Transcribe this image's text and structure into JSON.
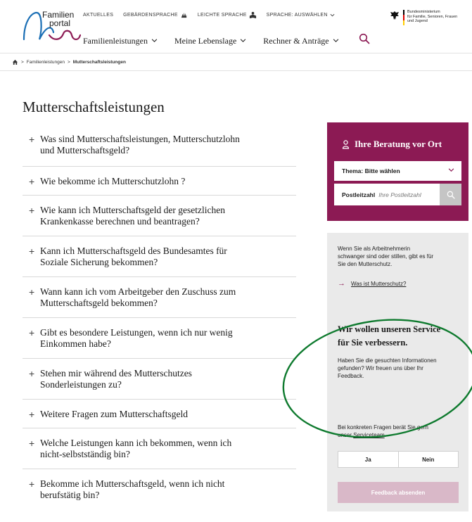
{
  "header": {
    "logo_line1": "Familien",
    "logo_line2": "portal",
    "topnav": {
      "aktuelles": "AKTUELLES",
      "gebaerdensprache": "GEBÄRDENSPRACHE",
      "leichte_sprache": "LEICHTE SPRACHE",
      "sprache": "SPRACHE: AUSWÄHLEN"
    },
    "mainnav": {
      "item1": "Familienleistungen",
      "item2": "Meine Lebenslage",
      "item3": "Rechner & Anträge"
    },
    "ministry": {
      "line1": "Bundesministerium",
      "line2": "für Familie, Senioren, Frauen",
      "line3": "und Jugend"
    }
  },
  "breadcrumb": {
    "item1": "Familienleistungen",
    "item2": "Mutterschaftsleistungen"
  },
  "page_title": "Mutterschaftsleistungen",
  "faq": [
    {
      "line1": "Was sind Mutterschaftsleistungen, Mutterschutzlohn",
      "line2": "und Mutterschaftsgeld?"
    },
    {
      "line1": "Wie bekomme ich Mutterschutzlohn ?",
      "line2": ""
    },
    {
      "line1": "Wie kann ich Mutterschaftsgeld der gesetzlichen",
      "line2": "Krankenkasse berechnen und beantragen?"
    },
    {
      "line1": "Kann ich Mutterschaftsgeld des Bundesamtes für",
      "line2": "Soziale Sicherung bekommen?"
    },
    {
      "line1": "Wann kann ich vom Arbeitgeber den Zuschuss zum",
      "line2": "Mutterschaftsgeld bekommen?"
    },
    {
      "line1": "Gibt es besondere Leistungen, wenn ich nur wenig",
      "line2": "Einkommen habe?"
    },
    {
      "line1": "Stehen mir während des Mutterschutzes",
      "line2": "Sonderleistungen zu?"
    },
    {
      "line1": "Weitere Fragen zum Mutterschaftsgeld",
      "line2": ""
    },
    {
      "line1": "Welche Leistungen kann ich bekommen, wenn ich",
      "line2": "nicht-selbstständig bin?"
    },
    {
      "line1": "Bekomme ich Mutterschaftsgeld, wenn ich nicht",
      "line2": "berufstätig bin?"
    }
  ],
  "advice": {
    "title": "Ihre Beratung vor Ort",
    "select_value": "Thema: Bitte wählen",
    "zip_label": "Postleitzahl",
    "zip_placeholder": "Ihre Postleitzahl"
  },
  "info": {
    "line1": "Wenn Sie als Arbeitnehmerin",
    "line2": "schwanger sind oder stillen, gibt es für",
    "line3": "Sie den Mutterschutz.",
    "link": "Was ist Mutterschutz?"
  },
  "feedback": {
    "title_line1": "Wir wollen unseren Service",
    "title_line2": "für Sie verbessern.",
    "text_line1": "Haben Sie die gesuchten Informationen",
    "text_line2": "gefunden? Wir freuen uns über Ihr",
    "text_line3": "Feedback.",
    "contact_line1": "Bei konkreten Fragen berät Sie gern",
    "contact_prefix": "unser ",
    "contact_link": "Serviceteam",
    "contact_suffix": ".",
    "yes": "Ja",
    "no": "Nein",
    "submit": "Feedback absenden"
  },
  "colors": {
    "accent": "#8c1a54",
    "annotation": "#0e7a2e"
  }
}
